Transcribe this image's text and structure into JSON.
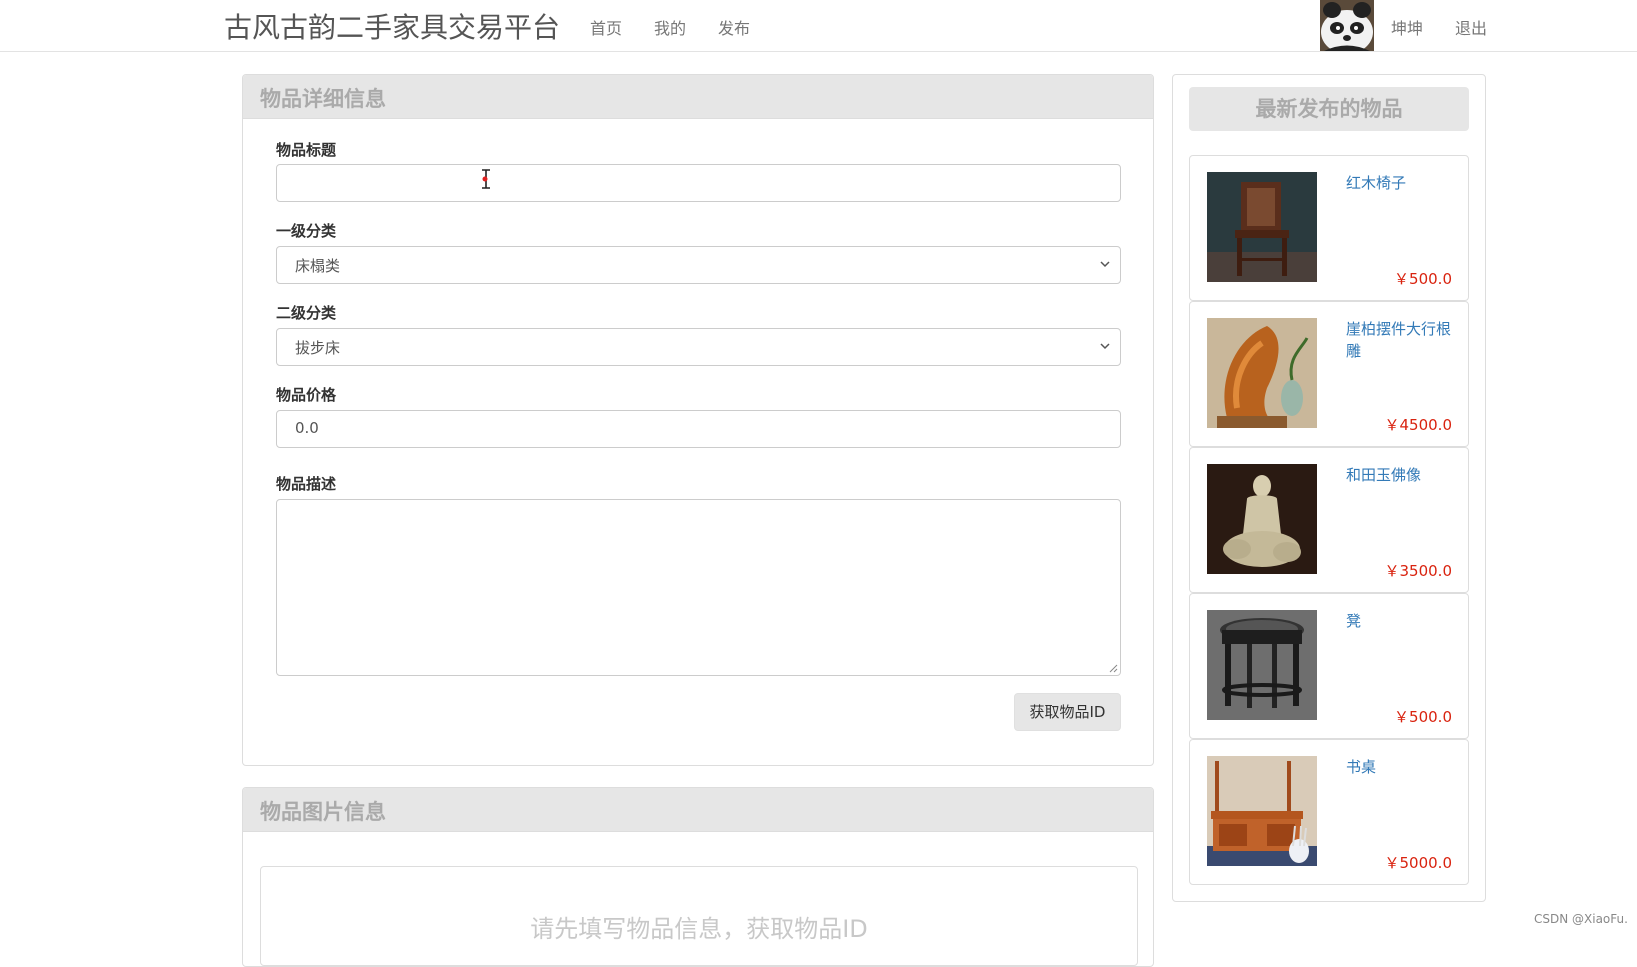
{
  "navbar": {
    "brand": "古风古韵二手家具交易平台",
    "links": [
      "首页",
      "我的",
      "发布"
    ],
    "username": "坤坤",
    "logout": "退出"
  },
  "detail_panel": {
    "heading": "物品详细信息",
    "title_label": "物品标题",
    "title_value": "",
    "category1_label": "一级分类",
    "category1_value": "床榻类",
    "category2_label": "二级分类",
    "category2_value": "拔步床",
    "price_label": "物品价格",
    "price_value": "0.0",
    "desc_label": "物品描述",
    "desc_value": "",
    "get_id_button": "获取物品ID"
  },
  "image_panel": {
    "heading": "物品图片信息",
    "hint": "请先填写物品信息，获取物品ID"
  },
  "sidebar": {
    "heading": "最新发布的物品",
    "items": [
      {
        "title": "红木椅子",
        "price": "￥500.0"
      },
      {
        "title": "崖柏摆件大行根雕",
        "price": "￥4500.0"
      },
      {
        "title": "和田玉佛像",
        "price": "￥3500.0"
      },
      {
        "title": "凳",
        "price": "￥500.0"
      },
      {
        "title": "书桌",
        "price": "￥5000.0"
      }
    ]
  },
  "watermark": "CSDN @XiaoFu.",
  "colors": {
    "link": "#337ab7",
    "price": "#d9230f",
    "panel_heading_bg": "#e6e6e6"
  }
}
